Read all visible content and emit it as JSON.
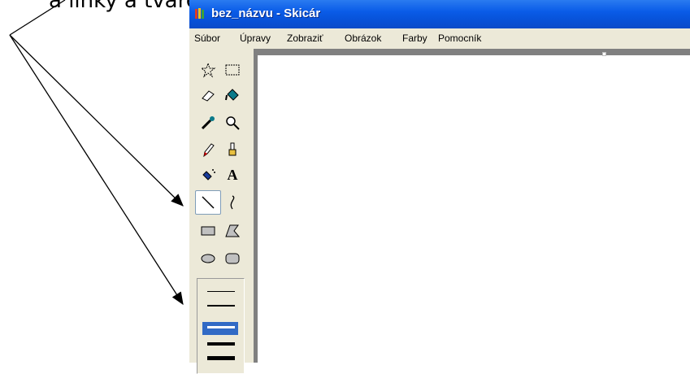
{
  "window": {
    "title": "bez_názvu - Skicár",
    "titlebar_color": "#0a5ce8"
  },
  "menu": {
    "items": [
      "Súbor",
      "Úpravy",
      "Zobraziť",
      "Obrázok",
      "Farby",
      "Pomocník"
    ]
  },
  "toolbox": {
    "tools": [
      {
        "name": "free-form-select",
        "icon": "star-select-icon"
      },
      {
        "name": "select",
        "icon": "rect-select-icon"
      },
      {
        "name": "eraser",
        "icon": "eraser-icon"
      },
      {
        "name": "fill",
        "icon": "paint-bucket-icon"
      },
      {
        "name": "pick-color",
        "icon": "eyedropper-icon"
      },
      {
        "name": "magnifier",
        "icon": "magnifier-icon"
      },
      {
        "name": "pencil",
        "icon": "pencil-icon"
      },
      {
        "name": "brush",
        "icon": "brush-icon"
      },
      {
        "name": "airbrush",
        "icon": "airbrush-icon"
      },
      {
        "name": "text",
        "icon": "text-icon",
        "label": "A"
      },
      {
        "name": "line",
        "icon": "line-icon",
        "selected": true
      },
      {
        "name": "curve",
        "icon": "curve-icon"
      },
      {
        "name": "rectangle",
        "icon": "rectangle-icon"
      },
      {
        "name": "polygon",
        "icon": "polygon-icon"
      },
      {
        "name": "ellipse",
        "icon": "ellipse-icon"
      },
      {
        "name": "rounded-rectangle",
        "icon": "rounded-rect-icon"
      }
    ],
    "line_widths": [
      1,
      2,
      3,
      4
    ],
    "selected_width_index": 2,
    "selection_color": "#316ac5"
  },
  "caption": {
    "visible_text": "a linky a tvare"
  }
}
